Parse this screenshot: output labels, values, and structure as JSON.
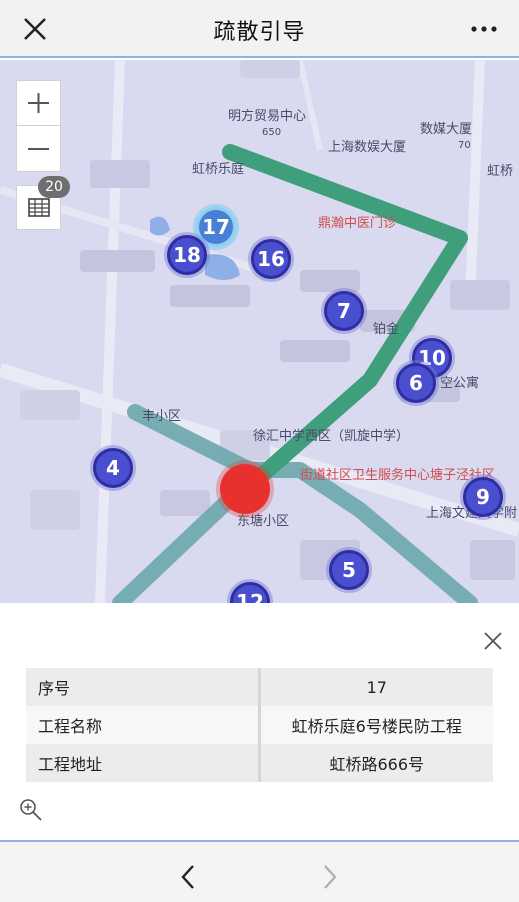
{
  "header": {
    "title": "疏散引导",
    "close_icon": "close-icon",
    "more_icon": "more-icon"
  },
  "map": {
    "labels": {
      "mingfang": "明方贸易中心",
      "shumei": "数媒大厦",
      "shuyu": "上海数娱大厦",
      "hongqiao_le": "虹桥乐庭",
      "hongqiao_r": "虹桥",
      "dingxiang": "鼎瀚中医门诊",
      "xiaoqu": "丰小区",
      "xuhui": "徐汇中学西区（凯旋中学）",
      "street": "街道社区卫生服务中心塘子泾社区",
      "dongtang": "东塘小区",
      "wenjian": "上海文建大学附",
      "kongong": "空公寓",
      "jin": "铂金",
      "num650": "650",
      "num70": "70"
    },
    "count_badge": "20",
    "markers": [
      {
        "label": "17",
        "selected": true
      },
      {
        "label": "18"
      },
      {
        "label": "16"
      },
      {
        "label": "7"
      },
      {
        "label": "10"
      },
      {
        "label": "6"
      },
      {
        "label": "4"
      },
      {
        "label": "9"
      },
      {
        "label": "5"
      },
      {
        "label": "12"
      }
    ],
    "colors": {
      "route_green": "#3f9e7c",
      "route_teal": "#6aa7ac",
      "marker_blue": "#4a4fd0",
      "current_red": "#e8312f"
    }
  },
  "info": {
    "rows": [
      {
        "key": "序号",
        "value": "17"
      },
      {
        "key": "工程名称",
        "value": "虹桥乐庭6号楼民防工程"
      },
      {
        "key": "工程地址",
        "value": "虹桥路666号"
      }
    ]
  },
  "footer": {
    "prev_icon": "chevron-left-icon",
    "next_icon": "chevron-right-icon"
  }
}
